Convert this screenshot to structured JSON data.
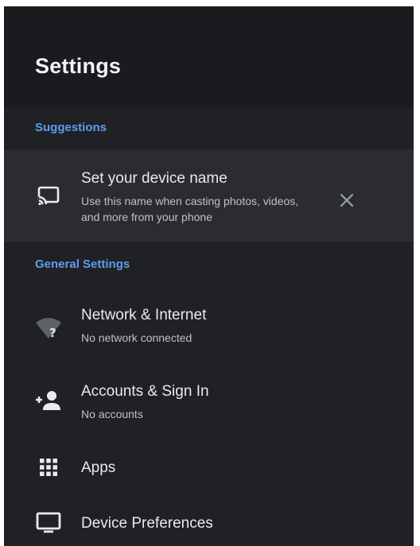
{
  "header": {
    "title": "Settings"
  },
  "sections": {
    "suggestions": {
      "label": "Suggestions"
    },
    "general": {
      "label": "General Settings"
    }
  },
  "suggestion": {
    "title": "Set your device name",
    "subtitle_line1": "Use this name when casting photos, videos,",
    "subtitle_line2": "and more from your phone",
    "icon": "cast-icon",
    "dismiss_icon": "close-icon"
  },
  "items": [
    {
      "title": "Network & Internet",
      "subtitle": "No network connected",
      "icon": "wifi-unknown-icon"
    },
    {
      "title": "Accounts & Sign In",
      "subtitle": "No accounts",
      "icon": "add-account-icon"
    },
    {
      "title": "Apps",
      "icon": "apps-grid-icon"
    },
    {
      "title": "Device Preferences",
      "icon": "tv-icon"
    }
  ],
  "colors": {
    "background": "#202124",
    "header_bg": "#1a1b1e",
    "card_bg": "#2b2c30",
    "accent": "#5e9cf0",
    "text_primary": "#e8eaed",
    "text_secondary": "#bdc1c6"
  }
}
